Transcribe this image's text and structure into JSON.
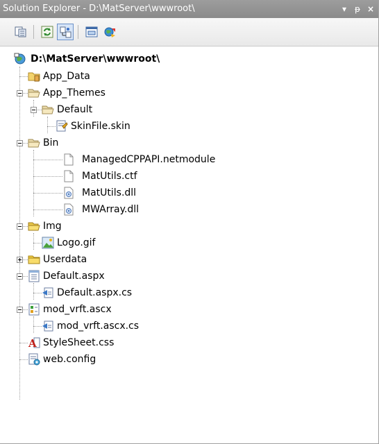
{
  "window": {
    "title": "Solution Explorer - D:\\MatServer\\wwwroot\\",
    "dropdown_glyph": "▾",
    "pin_glyph": "ᵽ",
    "close_glyph": "×"
  },
  "toolbar": {
    "buttons": [
      {
        "name": "properties-button",
        "icon": "properties-icon"
      },
      {
        "name": "refresh-button",
        "icon": "refresh-icon"
      },
      {
        "name": "nest-related-files-button",
        "icon": "nest-files-icon",
        "active": true
      },
      {
        "name": "view-designer-button",
        "icon": "view-designer-icon"
      },
      {
        "name": "copy-website-button",
        "icon": "copy-website-icon"
      }
    ]
  },
  "tree": {
    "root": "D:\\MatServer\\wwwroot\\",
    "items": [
      {
        "label": "App_Data"
      },
      {
        "label": "App_Themes"
      },
      {
        "label": "Default"
      },
      {
        "label": "SkinFile.skin"
      },
      {
        "label": "Bin"
      },
      {
        "label": "ManagedCPPAPI.netmodule"
      },
      {
        "label": "MatUtils.ctf"
      },
      {
        "label": "MatUtils.dll"
      },
      {
        "label": "MWArray.dll"
      },
      {
        "label": "Img"
      },
      {
        "label": "Logo.gif"
      },
      {
        "label": "Userdata"
      },
      {
        "label": "Default.aspx"
      },
      {
        "label": "Default.aspx.cs"
      },
      {
        "label": "mod_vrft.ascx"
      },
      {
        "label": "mod_vrft.ascx.cs"
      },
      {
        "label": "StyleSheet.css"
      },
      {
        "label": "web.config"
      }
    ]
  }
}
